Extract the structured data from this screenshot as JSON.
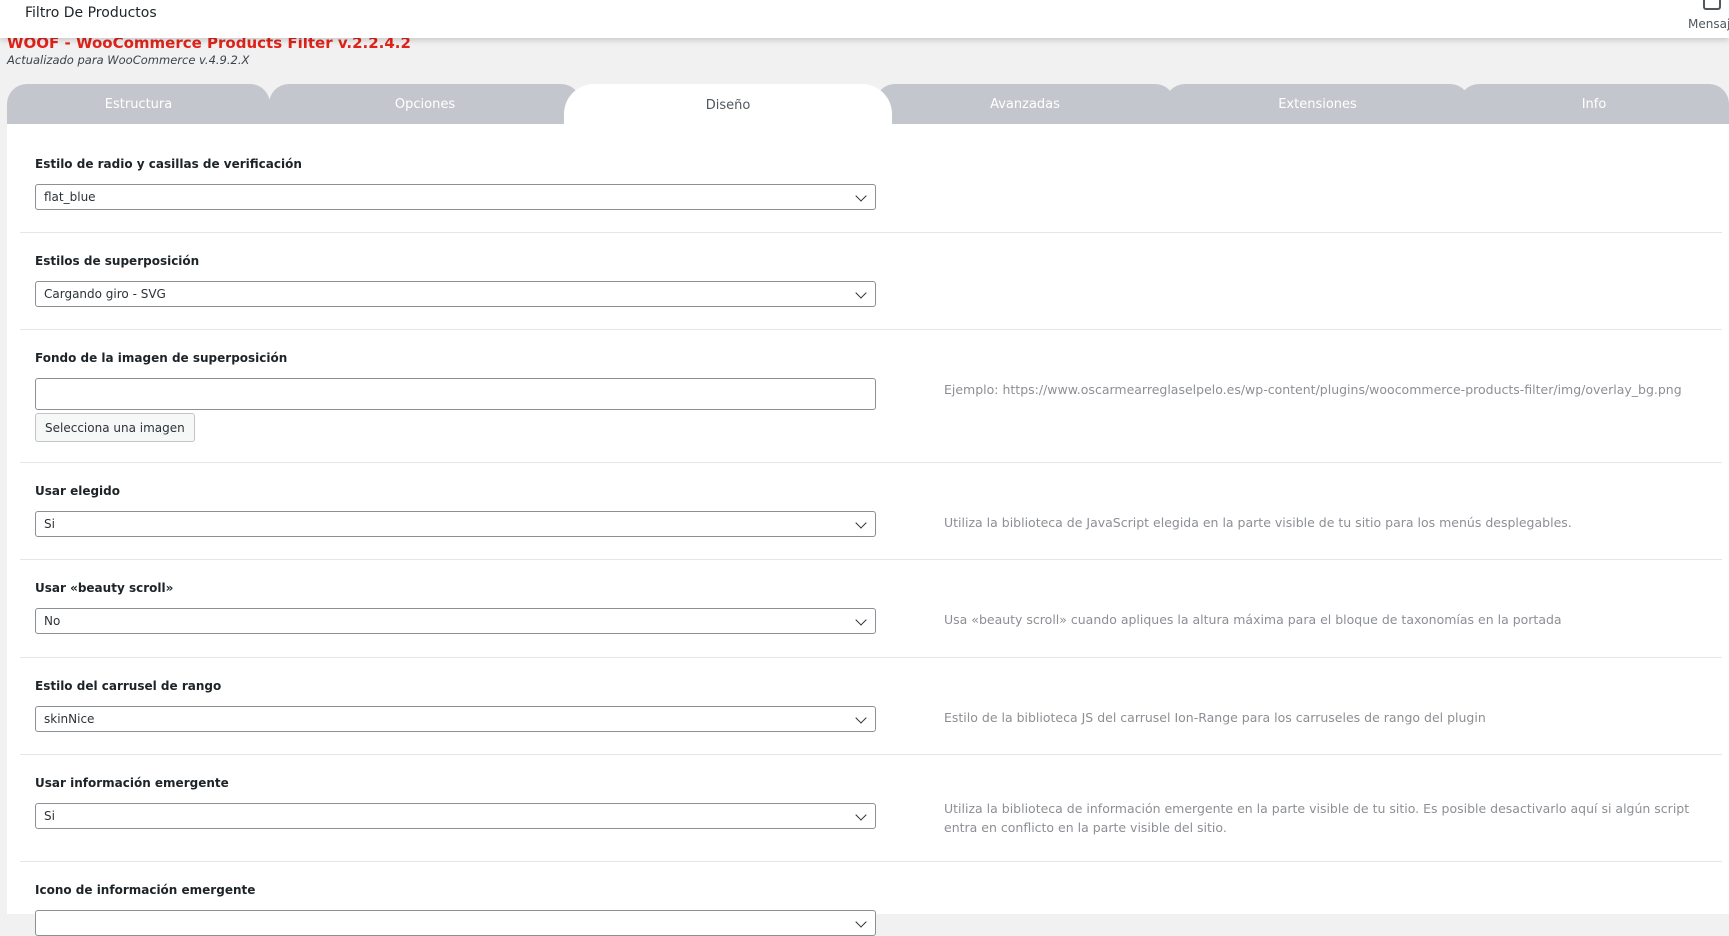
{
  "topbar": {
    "title": "Filtro De Productos",
    "messages_label": "Mensaje",
    "messages_icon": "inbox-icon"
  },
  "plugin": {
    "title": "WOOF - WooCommerce Products Filter v.2.2.4.2",
    "subtitle": "Actualizado para WooCommerce v.4.9.2.X",
    "title_color": "#e2231a"
  },
  "tabs": [
    {
      "label": "Estructura",
      "active": false
    },
    {
      "label": "Opciones",
      "active": false
    },
    {
      "label": "Diseño",
      "active": true
    },
    {
      "label": "Avanzadas",
      "active": false
    },
    {
      "label": "Extensiones",
      "active": false
    },
    {
      "label": "Info",
      "active": false
    }
  ],
  "settings": [
    {
      "label": "Estilo de radio y casillas de verificación",
      "type": "select",
      "value": "flat_blue",
      "description": ""
    },
    {
      "label": "Estilos de superposición",
      "type": "select",
      "value": "Cargando giro - SVG",
      "description": ""
    },
    {
      "label": "Fondo de la imagen de superposición",
      "type": "image",
      "value": "",
      "button_label": "Selecciona una imagen",
      "description": "Ejemplo: https://www.oscarmearreglaselpelo.es/wp-content/plugins/woocommerce-products-filter/img/overlay_bg.png"
    },
    {
      "label": "Usar elegido",
      "type": "select",
      "value": "Si",
      "description": "Utiliza la biblioteca de JavaScript elegida en la parte visible de tu sitio para los menús desplegables."
    },
    {
      "label": "Usar «beauty scroll»",
      "type": "select",
      "value": "No",
      "description": "Usa «beauty scroll» cuando apliques la altura máxima para el bloque de taxonomías en la portada"
    },
    {
      "label": "Estilo del carrusel de rango",
      "type": "select",
      "value": "skinNice",
      "description": "Estilo de la biblioteca JS del carrusel Ion-Range para los carruseles de rango del plugin"
    },
    {
      "label": "Usar información emergente",
      "type": "select",
      "value": "Si",
      "description": "Utiliza la biblioteca de información emergente en la parte visible de tu sitio. Es posible desactivarlo aquí si algún script entra en conflicto en la parte visible del sitio."
    },
    {
      "label": "Icono de información emergente",
      "type": "select",
      "value": "",
      "description": ""
    }
  ]
}
